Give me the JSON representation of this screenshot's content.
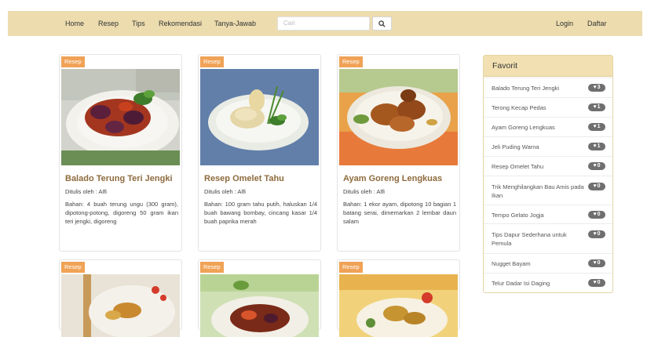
{
  "nav": {
    "home": "Home",
    "resep": "Resep",
    "tips": "Tips",
    "rekomendasi": "Rekomendasi",
    "tanya": "Tanya-Jawab",
    "search_placeholder": "Cari",
    "login": "Login",
    "daftar": "Daftar",
    "search_icon": "search-icon"
  },
  "cards": [
    {
      "badge": "Resep",
      "title": "Balado Terung Teri Jengki",
      "author": "Ditulis oleh : Alfi",
      "desc": "Bahan: 4 buah terung ungu (300 gram), dipotong-potong, digoreng 50 gram ikan teri jengki, digoreng"
    },
    {
      "badge": "Resep",
      "title": "Resep Omelet Tahu",
      "author": "Ditulis oleh : Alfi",
      "desc": "Bahan: 100 gram tahu putih, haluskan 1/4 buah bawang bombay, cincang kasar 1/4 buah paprika merah"
    },
    {
      "badge": "Resep",
      "title": "Ayam Goreng Lengkuas",
      "author": "Ditulis oleh : Alfi",
      "desc": "Bahan: 1 ekor ayam, dipotong 10 bagian 1 batang serai, dimemarkan 2 lembar daun salam"
    },
    {
      "badge": "Resep"
    },
    {
      "badge": "Resep"
    },
    {
      "badge": "Resep"
    }
  ],
  "favorit": {
    "title": "Favorit",
    "items": [
      {
        "label": "Balado Terung Teri Jengki",
        "count": "3"
      },
      {
        "label": "Terong Kecap Pedas",
        "count": "1"
      },
      {
        "label": "Ayam Goreng Lengkuas",
        "count": "1"
      },
      {
        "label": "Jeli Puding Warna",
        "count": "1"
      },
      {
        "label": "Resep Omelet Tahu",
        "count": "0"
      },
      {
        "label": "Trik Menghilangkan Bau Amis pada Ikan",
        "count": "0"
      },
      {
        "label": "Tempo Gelato Jogja",
        "count": "0"
      },
      {
        "label": "Tips Dapur Sederhana untuk Pemula",
        "count": "0"
      },
      {
        "label": "Nugget Bayam",
        "count": "0"
      },
      {
        "label": "Telur Dadar Isi Daging",
        "count": "0"
      }
    ]
  },
  "colors": {
    "navbar": "#ecdcae",
    "badge": "#f0a256",
    "title": "#8e6b3d",
    "count_badge": "#6f6f6f"
  }
}
